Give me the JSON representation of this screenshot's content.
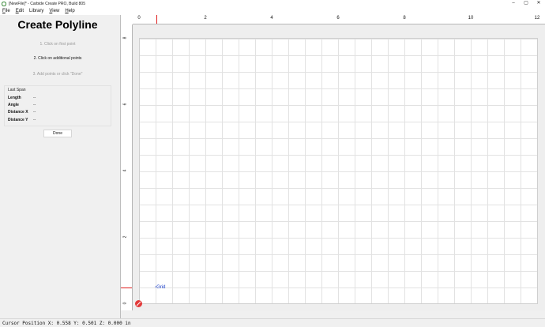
{
  "window": {
    "title": "[NewFile]* - Carbide Create PRO, Build 805",
    "controls": [
      "–",
      "▢",
      "✕"
    ]
  },
  "menu": [
    {
      "key": "F",
      "rest": "ile"
    },
    {
      "key": "E",
      "rest": "dit"
    },
    {
      "key": "",
      "rest": "Library"
    },
    {
      "key": "V",
      "rest": "iew"
    },
    {
      "key": "H",
      "rest": "elp"
    }
  ],
  "panel": {
    "title": "Create Polyline",
    "steps": [
      "1. Click on first point",
      "2. Click on additional points",
      "3. Add points or click \"Done\""
    ],
    "last_span": {
      "title": "Last Span",
      "rows": [
        {
          "label": "Length",
          "value": "--"
        },
        {
          "label": "Angle",
          "value": "--"
        },
        {
          "label": "Distance X",
          "value": "--"
        },
        {
          "label": "Distance Y",
          "value": "--"
        }
      ]
    },
    "done_label": "Done"
  },
  "ruler": {
    "x_labels": [
      "0",
      "2",
      "4",
      "6",
      "8",
      "10",
      "12"
    ],
    "y_labels": [
      "8",
      "6",
      "4",
      "2",
      "0"
    ]
  },
  "canvas": {
    "grid_label": "Grid"
  },
  "status": {
    "text": "Cursor Position X: 0.558 Y: 0.501 Z: 0.000 in"
  },
  "colors": {
    "accent_red": "#e02020",
    "grid_label": "#1a3ec9"
  }
}
